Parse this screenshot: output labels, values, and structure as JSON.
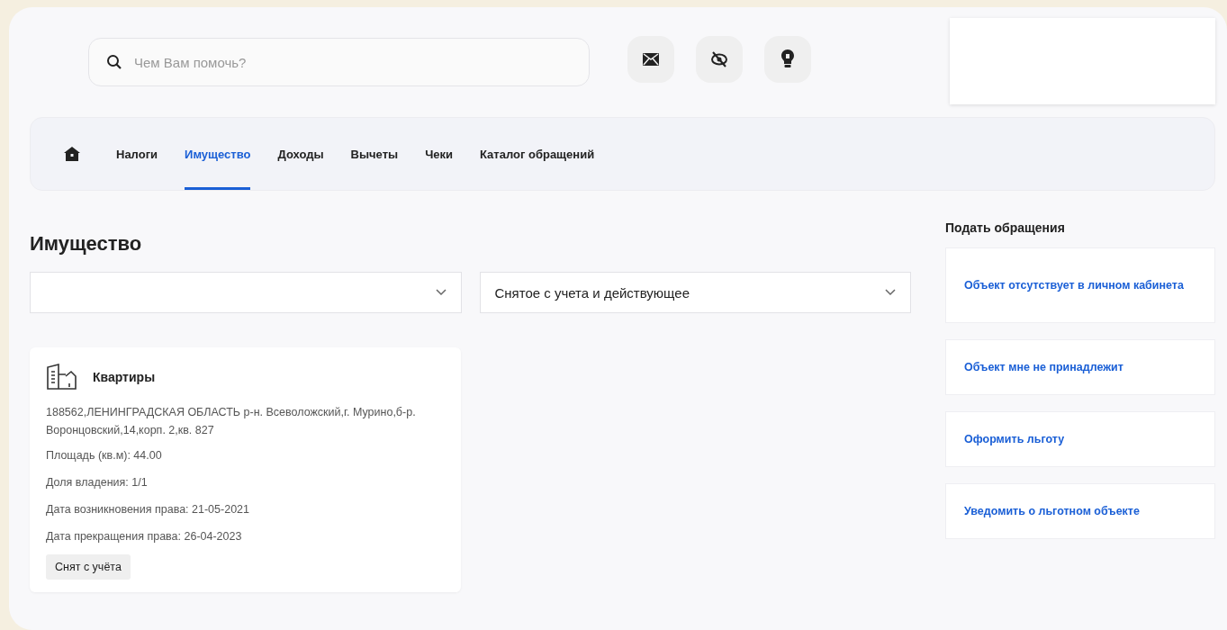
{
  "search": {
    "placeholder": "Чем Вам помочь?"
  },
  "nav": {
    "tabs": [
      {
        "label": "Налоги",
        "selected": false
      },
      {
        "label": "Имущество",
        "selected": true
      },
      {
        "label": "Доходы",
        "selected": false
      },
      {
        "label": "Вычеты",
        "selected": false
      },
      {
        "label": "Чеки",
        "selected": false
      },
      {
        "label": "Каталог обращений",
        "selected": false
      }
    ]
  },
  "page_title": "Имущество",
  "filters": [
    {
      "expanded": false
    },
    {
      "expanded": false,
      "value": "Снятое с учета и действующее"
    }
  ],
  "property_card": {
    "title": "Квартиры",
    "address": "188562,ЛЕНИНГРАДСКАЯ ОБЛАСТЬ р-н. Всеволожский,г. Мурино,б-р. Воронцовский,14,корп. 2,кв. 827",
    "details": [
      "Площадь (кв.м): 44.00",
      "Доля владения: 1/1",
      "Дата возникновения права: 21-05-2021",
      "Дата прекращения права: 26-04-2023"
    ],
    "status": "Снят с учёта"
  },
  "appeals": {
    "title": "Подать обращения",
    "items": [
      "Объект отсутствует в личном кабинета",
      "Объект мне не принадлежит",
      "Оформить льготу",
      "Уведомить о льготном объекте"
    ]
  }
}
